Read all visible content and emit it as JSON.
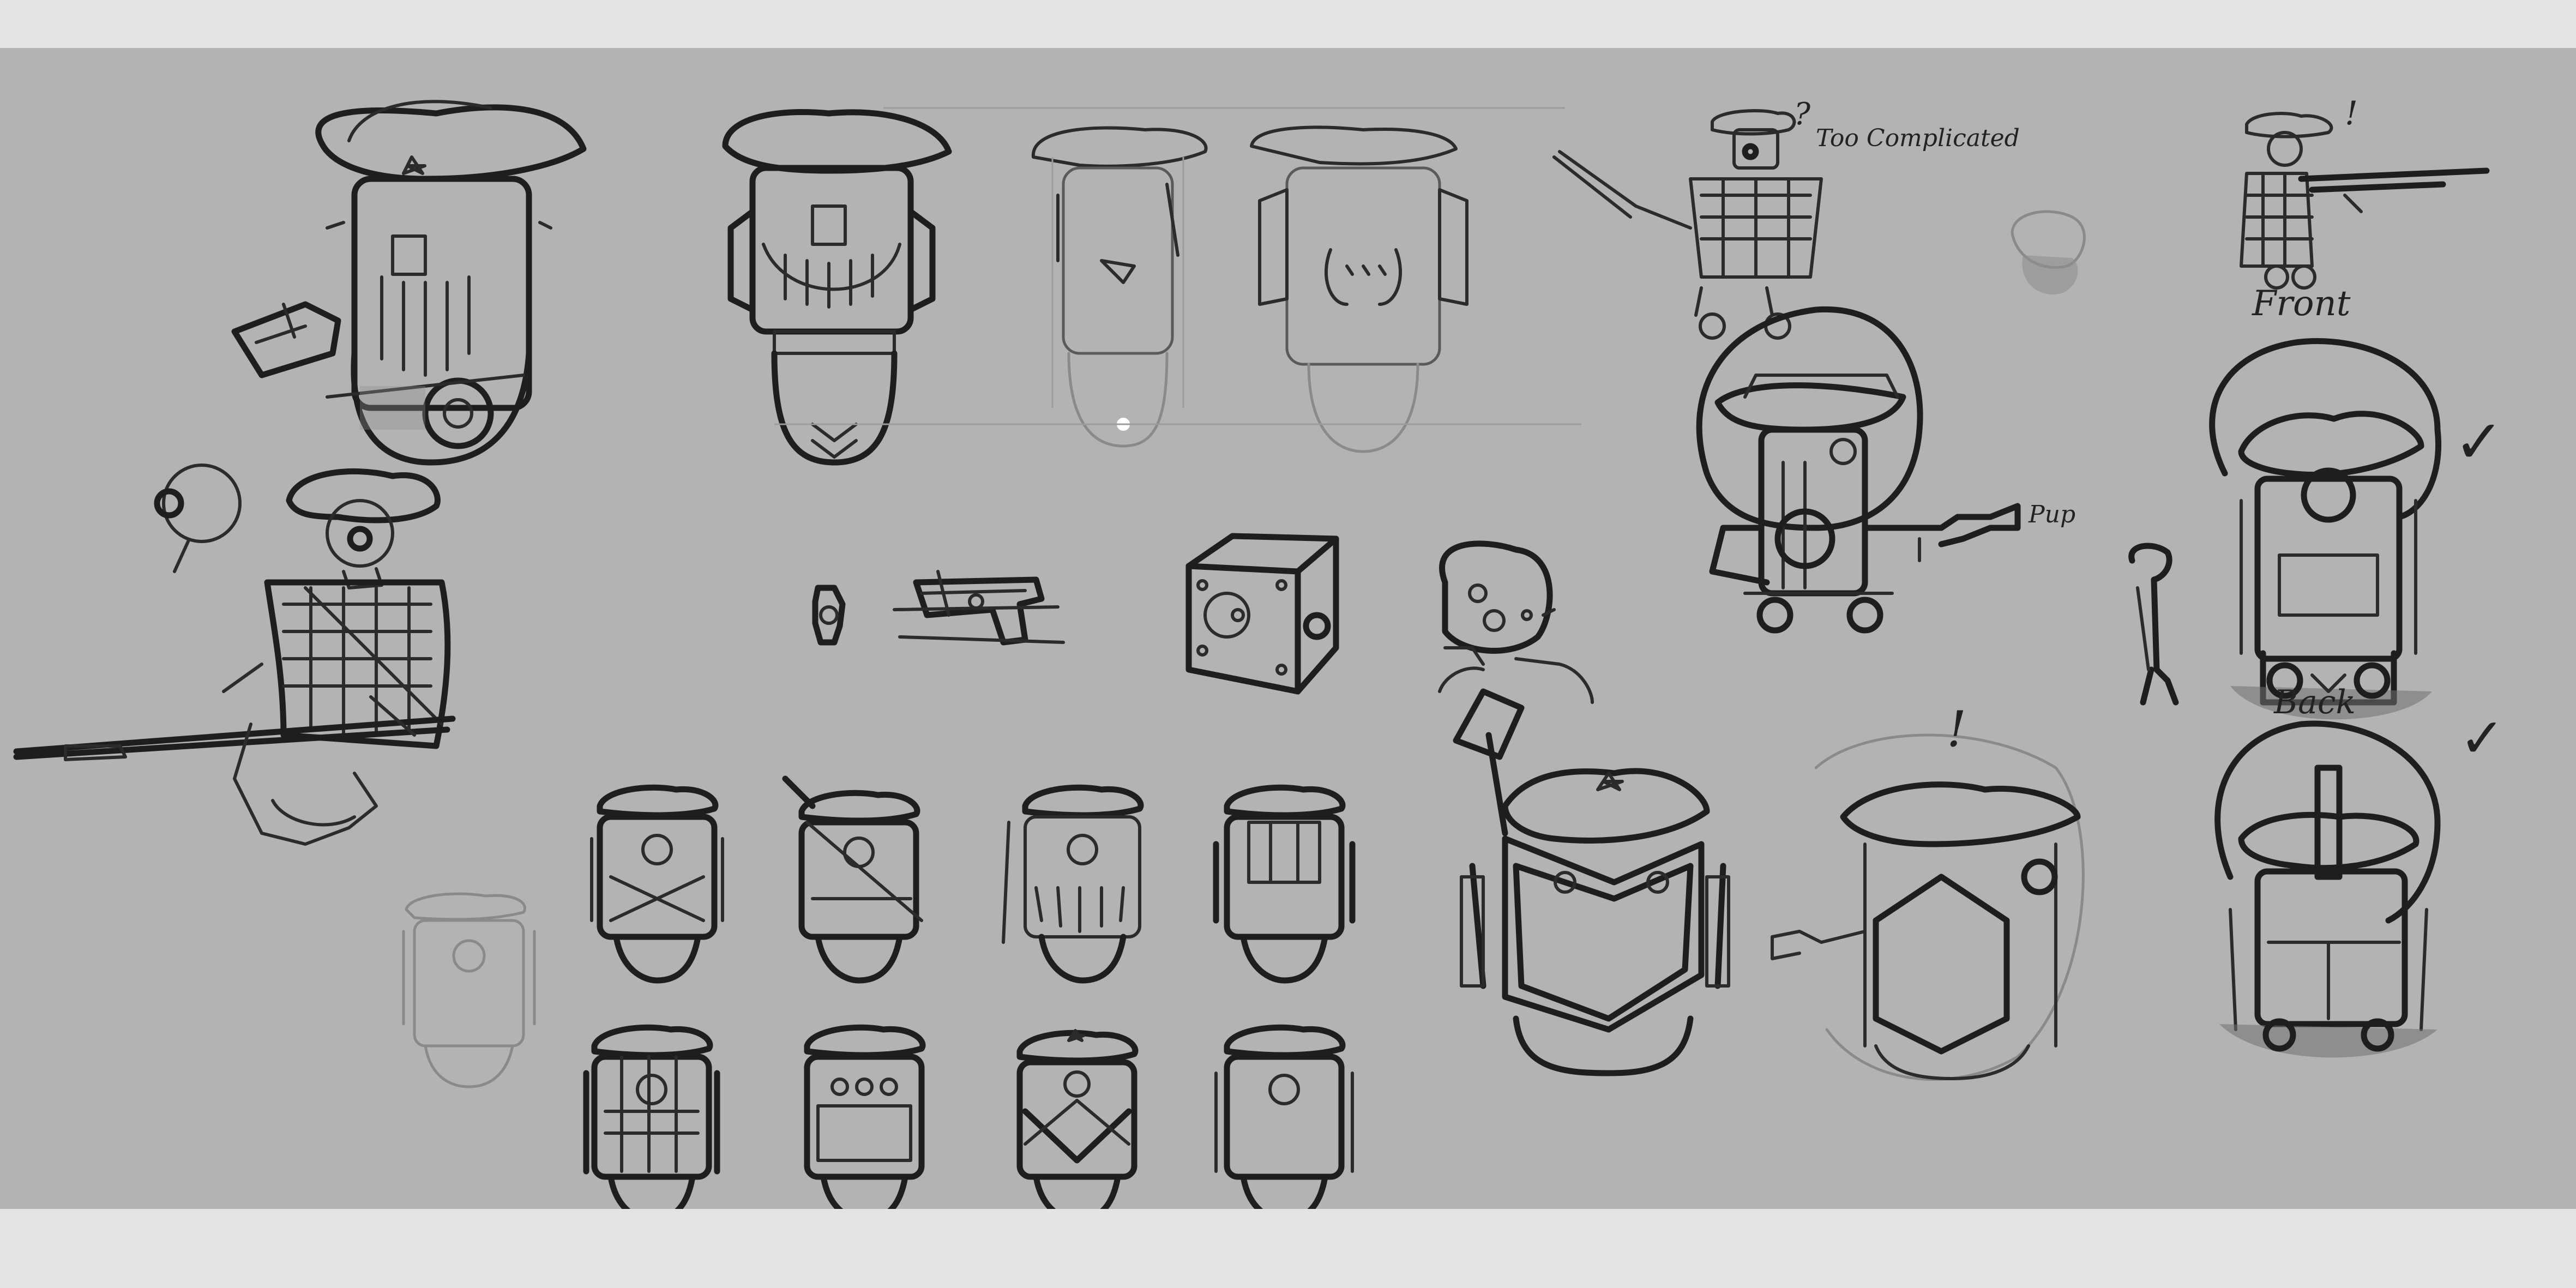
{
  "sheet": {
    "background_color": "#b3b3b3",
    "frame_color": "#e4e4e4",
    "ink_color": "#2b2b2b"
  },
  "annotations": {
    "too_complicated": "Too Complicated",
    "question_mark": "?",
    "exclaim_top": "!",
    "exclaim_middle": "!",
    "pew_sound": "Pup",
    "front_label": "Front",
    "back_label": "Back",
    "front_check": "✓",
    "back_check": "✓"
  }
}
